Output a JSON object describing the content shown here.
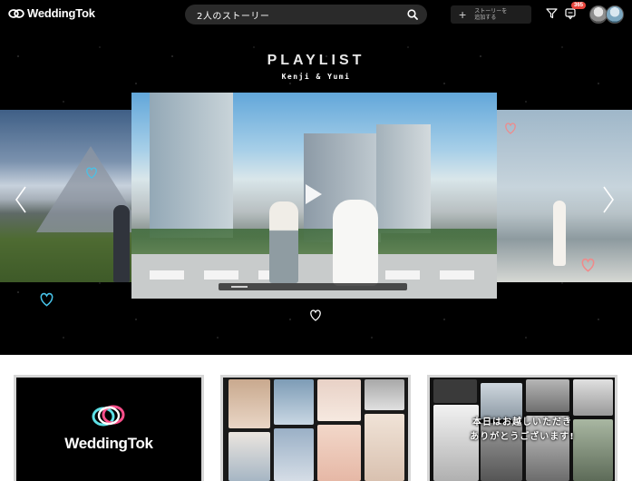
{
  "header": {
    "logo_text": "WeddingTok",
    "search": {
      "value": "2人のストーリー"
    },
    "add_story_label": "ストーリーを\n追加する",
    "notification_count": "365"
  },
  "hero": {
    "title": "PLAYLIST",
    "subtitle": "Kenji & Yumi",
    "video_progress": 0.1
  },
  "thumbnails": [
    {
      "logo_text": "WeddingTok"
    },
    {},
    {
      "caption": "本日はお越しいただき\nありがとうございます!"
    }
  ],
  "colors": {
    "accent_heart": "#47c2e8",
    "pink_heart": "#f08a8a",
    "badge": "#e8453c",
    "background": "#000000"
  },
  "icons": [
    "logo-icon",
    "search-icon",
    "plus-icon",
    "filter-icon",
    "notification-icon",
    "chevron-left-icon",
    "chevron-right-icon",
    "play-icon",
    "heart-icon"
  ]
}
